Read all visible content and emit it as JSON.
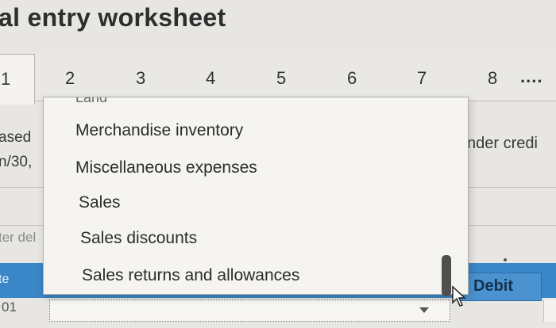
{
  "page": {
    "title": "al entry worksheet"
  },
  "tabs": [
    {
      "label": "1"
    },
    {
      "label": "2"
    },
    {
      "label": "3"
    },
    {
      "label": "4"
    },
    {
      "label": "5"
    },
    {
      "label": "6"
    },
    {
      "label": "7"
    },
    {
      "label": "8"
    },
    {
      "label": "...."
    }
  ],
  "left_column": {
    "line1": "ased",
    "line2": "n/30,",
    "line3": "ter del",
    "header_label": "te",
    "row_number": "01"
  },
  "right_column": {
    "text": "nder credi"
  },
  "table_header": {
    "debit_label": "Debit"
  },
  "dropdown": {
    "cut_off_item": "Land",
    "options": [
      "Merchandise inventory",
      "Miscellaneous expenses",
      "Sales",
      "Sales discounts",
      "Sales returns and allowances"
    ]
  },
  "icons": {
    "dropdown_arrow": "chevron-down-icon",
    "cursor": "mouse-pointer-icon"
  },
  "colors": {
    "header_blue": "#3b86c6",
    "debit_cell": "#4b93d0",
    "background": "#e8e6e2"
  }
}
